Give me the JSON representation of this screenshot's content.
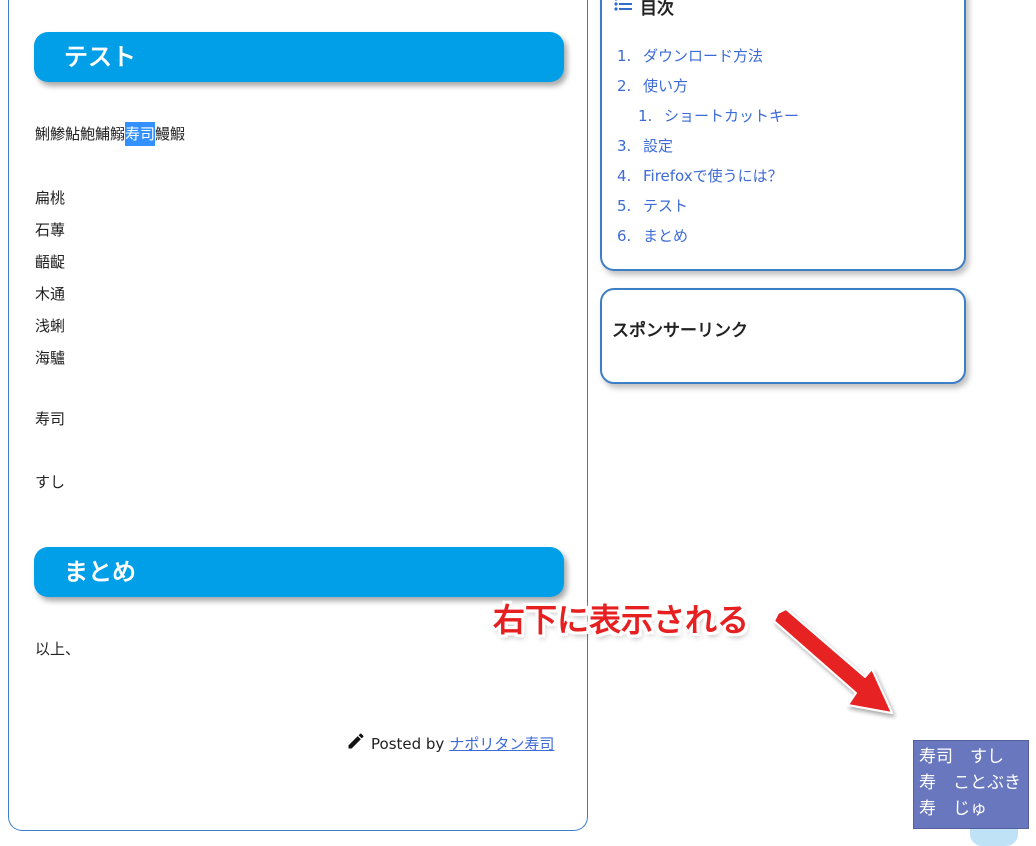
{
  "article": {
    "heading_test": "テスト",
    "fish_before": "鯏鯵鮎鮑鯆鰯",
    "fish_selected": "寿司",
    "fish_after": "鰻鰕",
    "kanji": [
      "扁桃",
      "石蓴",
      "齬齪",
      "木通",
      "浅蜊",
      "海驢"
    ],
    "sushi_kanji": "寿司",
    "sushi_kana": "すし",
    "heading_summary": "まとめ",
    "summary_text": "以上、",
    "posted_by_label": "Posted by",
    "author": "ナポリタン寿司"
  },
  "toc": {
    "title": "目次",
    "items": [
      {
        "num": "1.",
        "label": "ダウンロード方法"
      },
      {
        "num": "2.",
        "label": "使い方"
      },
      {
        "num": "1.",
        "label": "ショートカットキー",
        "sub": true
      },
      {
        "num": "3.",
        "label": "設定"
      },
      {
        "num": "4.",
        "label": "Firefoxで使うには？"
      },
      {
        "num": "5.",
        "label": "テスト"
      },
      {
        "num": "6.",
        "label": "まとめ"
      }
    ]
  },
  "sponsor": {
    "title": "スポンサーリンク"
  },
  "annotation": {
    "text": "右下に表示される",
    "color": "#e62020"
  },
  "popup": {
    "lines": [
      "寿司　すし",
      "寿　ことぶき",
      "寿　じゅ"
    ],
    "background": "#6877be"
  }
}
